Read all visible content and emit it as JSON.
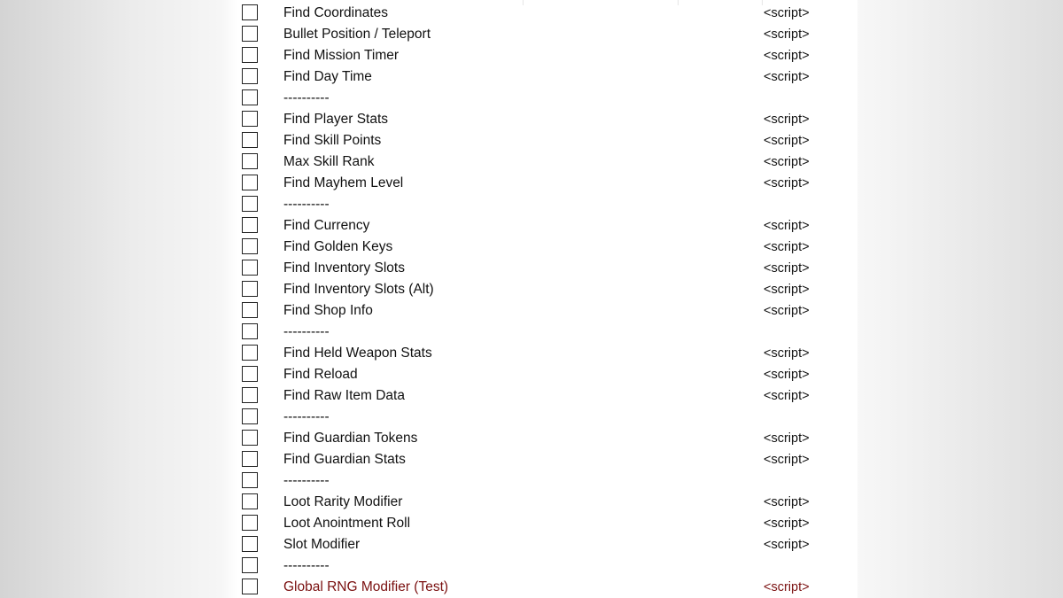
{
  "table": {
    "rows": [
      {
        "description": "Find Coordinates",
        "value": "<script>"
      },
      {
        "description": "Bullet Position / Teleport",
        "value": "<script>"
      },
      {
        "description": "Find Mission Timer",
        "value": "<script>"
      },
      {
        "description": "Find Day Time",
        "value": "<script>"
      },
      {
        "description": "----------",
        "value": ""
      },
      {
        "description": "Find Player Stats",
        "value": "<script>"
      },
      {
        "description": "Find Skill Points",
        "value": "<script>"
      },
      {
        "description": "Max Skill Rank",
        "value": "<script>"
      },
      {
        "description": "Find Mayhem Level",
        "value": "<script>"
      },
      {
        "description": "----------",
        "value": ""
      },
      {
        "description": "Find Currency",
        "value": "<script>"
      },
      {
        "description": "Find Golden Keys",
        "value": "<script>"
      },
      {
        "description": "Find Inventory Slots",
        "value": "<script>"
      },
      {
        "description": "Find Inventory Slots (Alt)",
        "value": "<script>"
      },
      {
        "description": "Find Shop Info",
        "value": "<script>"
      },
      {
        "description": "----------",
        "value": ""
      },
      {
        "description": "Find Held Weapon Stats",
        "value": "<script>"
      },
      {
        "description": "Find Reload",
        "value": "<script>"
      },
      {
        "description": "Find Raw Item Data",
        "value": "<script>"
      },
      {
        "description": "----------",
        "value": ""
      },
      {
        "description": "Find Guardian Tokens",
        "value": "<script>"
      },
      {
        "description": "Find Guardian Stats",
        "value": "<script>"
      },
      {
        "description": "----------",
        "value": ""
      },
      {
        "description": "Loot Rarity Modifier",
        "value": "<script>"
      },
      {
        "description": "Loot Anointment Roll",
        "value": "<script>"
      },
      {
        "description": "Slot Modifier",
        "value": "<script>"
      },
      {
        "description": "----------",
        "value": ""
      },
      {
        "description": "Global RNG Modifier (Test)",
        "value": "<script>",
        "highlight": true
      }
    ]
  },
  "colors": {
    "text": "#111111",
    "highlight": "#7a1010"
  }
}
